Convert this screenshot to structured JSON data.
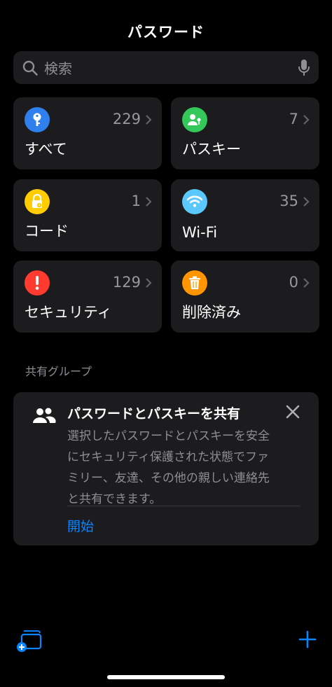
{
  "header": {
    "title": "パスワード"
  },
  "search": {
    "placeholder": "検索"
  },
  "categories": [
    {
      "label": "すべて",
      "count": "229",
      "icon": "key-icon",
      "color": "#2f80ed"
    },
    {
      "label": "パスキー",
      "count": "7",
      "icon": "person-badge-key-icon",
      "color": "#34c759"
    },
    {
      "label": "コード",
      "count": "1",
      "icon": "lock-clock-icon",
      "color": "#ffcc00"
    },
    {
      "label": "Wi-Fi",
      "count": "35",
      "icon": "wifi-icon",
      "color": "#5ac8fa"
    },
    {
      "label": "セキュリティ",
      "count": "129",
      "icon": "exclamation-icon",
      "color": "#ff3b30"
    },
    {
      "label": "削除済み",
      "count": "0",
      "icon": "trash-icon",
      "color": "#ff9500"
    }
  ],
  "shared": {
    "section_label": "共有グループ",
    "card_title": "パスワードとパスキーを共有",
    "card_body_lines": [
      "選択したパスワードとパスキーを安全",
      "にセキュリティ保護された状態でファ",
      "ミリー、友達、その他の親しい連絡先",
      "と共有できます。"
    ],
    "start_label": "開始"
  },
  "theme": {
    "accent": "#0a84ff",
    "background": "#000000",
    "surface": "#1c1c1e"
  }
}
